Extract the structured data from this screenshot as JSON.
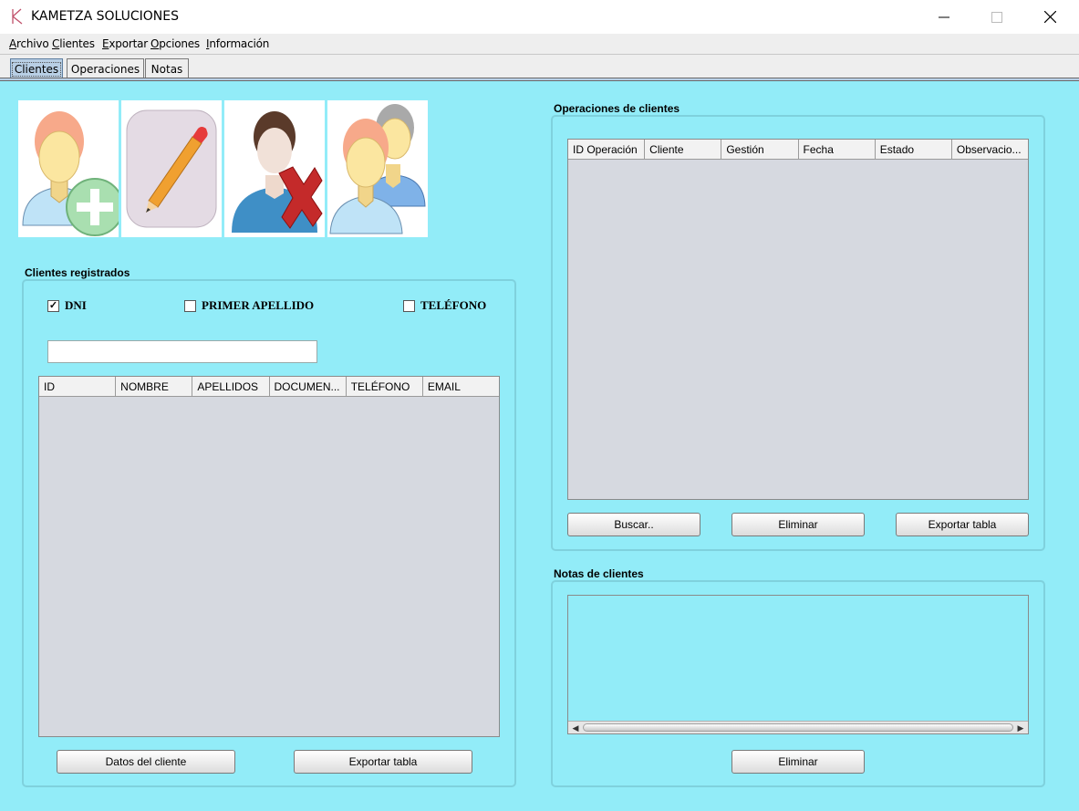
{
  "window": {
    "title": "KAMETZA SOLUCIONES",
    "minimize_symbol": "—",
    "close_symbol": "✕"
  },
  "menu": [
    {
      "key": "A",
      "rest": "rchivo"
    },
    {
      "key": "C",
      "rest": "lientes"
    },
    {
      "key": "E",
      "rest": "xportar"
    },
    {
      "key": "O",
      "rest": "pciones"
    },
    {
      "key": "I",
      "rest": "nformación"
    }
  ],
  "tabs": [
    {
      "label": "Clientes",
      "active": true
    },
    {
      "label": "Operaciones",
      "active": false
    },
    {
      "label": "Notas",
      "active": false
    }
  ],
  "toolbar": {
    "icons": [
      "add-client-icon",
      "edit-client-icon",
      "delete-client-icon",
      "clients-list-icon"
    ]
  },
  "clientes": {
    "title": "Clientes registrados",
    "filters": [
      {
        "label": "DNI",
        "checked": true
      },
      {
        "label": "PRIMER APELLIDO",
        "checked": false
      },
      {
        "label": "TELÉFONO",
        "checked": false
      }
    ],
    "search_value": "",
    "columns": [
      "ID",
      "NOMBRE",
      "APELLIDOS",
      "DOCUMEN...",
      "TELÉFONO",
      "EMAIL"
    ],
    "rows": [],
    "buttons": {
      "details": "Datos del cliente",
      "export": "Exportar tabla"
    }
  },
  "operaciones": {
    "title": "Operaciones de clientes",
    "columns": [
      "ID Operación",
      "Cliente",
      "Gestión",
      "Fecha",
      "Estado",
      "Observacio..."
    ],
    "rows": [],
    "buttons": {
      "search": "Buscar..",
      "delete": "Eliminar",
      "export": "Exportar tabla"
    }
  },
  "notas": {
    "title": "Notas de clientes",
    "buttons": {
      "delete": "Eliminar"
    }
  },
  "colors": {
    "background": "#92ecf8",
    "table_body": "#d6d9e0",
    "active_tab": "#b8cfe5"
  }
}
